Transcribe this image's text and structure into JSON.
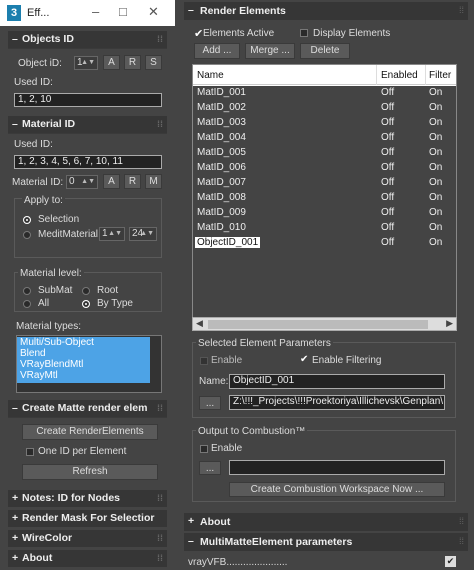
{
  "window": {
    "title": "Eff...",
    "logo": "3"
  },
  "objects_id": {
    "header": "Objects ID",
    "object_id_label": "Object iD:",
    "object_id_value": "1",
    "btn_a": "A",
    "btn_r": "R",
    "btn_s": "S",
    "used_id_label": "Used ID:",
    "used_id_value": "1, 2, 10"
  },
  "material_id": {
    "header": "Material ID",
    "used_id_label": "Used ID:",
    "used_id_value": "1, 2, 3, 4, 5, 6, 7, 10, 11",
    "material_id_label": "Material ID:",
    "material_id_value": "0",
    "btn_a": "A",
    "btn_r": "R",
    "btn_m": "M",
    "apply_to_label": "Apply to:",
    "apply_selection": "Selection",
    "apply_medit": "MeditMaterial",
    "medit_from": "1",
    "medit_to": "24",
    "level_label": "Material level:",
    "level_submat": "SubMat",
    "level_root": "Root",
    "level_all": "All",
    "level_bytype": "By Type",
    "types_label": "Material types:",
    "types": [
      "Multi/Sub-Object",
      "Blend",
      "VRayBlendMtl",
      "VRayMtl"
    ]
  },
  "matte": {
    "header": "Create Matte render elem",
    "create_btn": "Create RenderElements",
    "one_id_label": "One ID per Element",
    "refresh_btn": "Refresh"
  },
  "collapsed_rollouts": [
    "Notes: ID for Nodes",
    "Render Mask For Selectior",
    "WireColor",
    "About"
  ],
  "render_elements": {
    "header": "Render Elements",
    "elements_active": "Elements Active",
    "display_elements": "Display Elements",
    "add_btn": "Add ...",
    "merge_btn": "Merge ...",
    "delete_btn": "Delete",
    "columns": [
      "Name",
      "Enabled",
      "Filter"
    ],
    "rows": [
      {
        "name": "MatID_001",
        "enabled": "Off",
        "filter": "On"
      },
      {
        "name": "MatID_002",
        "enabled": "Off",
        "filter": "On"
      },
      {
        "name": "MatID_003",
        "enabled": "Off",
        "filter": "On"
      },
      {
        "name": "MatID_004",
        "enabled": "Off",
        "filter": "On"
      },
      {
        "name": "MatID_005",
        "enabled": "Off",
        "filter": "On"
      },
      {
        "name": "MatID_006",
        "enabled": "Off",
        "filter": "On"
      },
      {
        "name": "MatID_007",
        "enabled": "Off",
        "filter": "On"
      },
      {
        "name": "MatID_008",
        "enabled": "Off",
        "filter": "On"
      },
      {
        "name": "MatID_009",
        "enabled": "Off",
        "filter": "On"
      },
      {
        "name": "MatID_010",
        "enabled": "Off",
        "filter": "On"
      },
      {
        "name": "ObjectID_001",
        "enabled": "Off",
        "filter": "On"
      }
    ],
    "selected_params_label": "Selected Element Parameters",
    "enable_label": "Enable",
    "enable_filtering_label": "Enable Filtering",
    "name_label": "Name:",
    "name_value": "ObjectID_001",
    "browse_btn": "...",
    "path_value": "Z:\\!!!_Projects\\!!!Proektoriya\\Illichevsk\\Genplan\\",
    "combustion_label": "Output to Combustion™",
    "combustion_enable": "Enable",
    "combustion_browse": "...",
    "combustion_path": "",
    "create_combustion_btn": "Create Combustion Workspace Now ..."
  },
  "about_header": "About",
  "multimatte_header": "MultiMatteElement parameters",
  "vrayvfb": "vrayVFB......................"
}
